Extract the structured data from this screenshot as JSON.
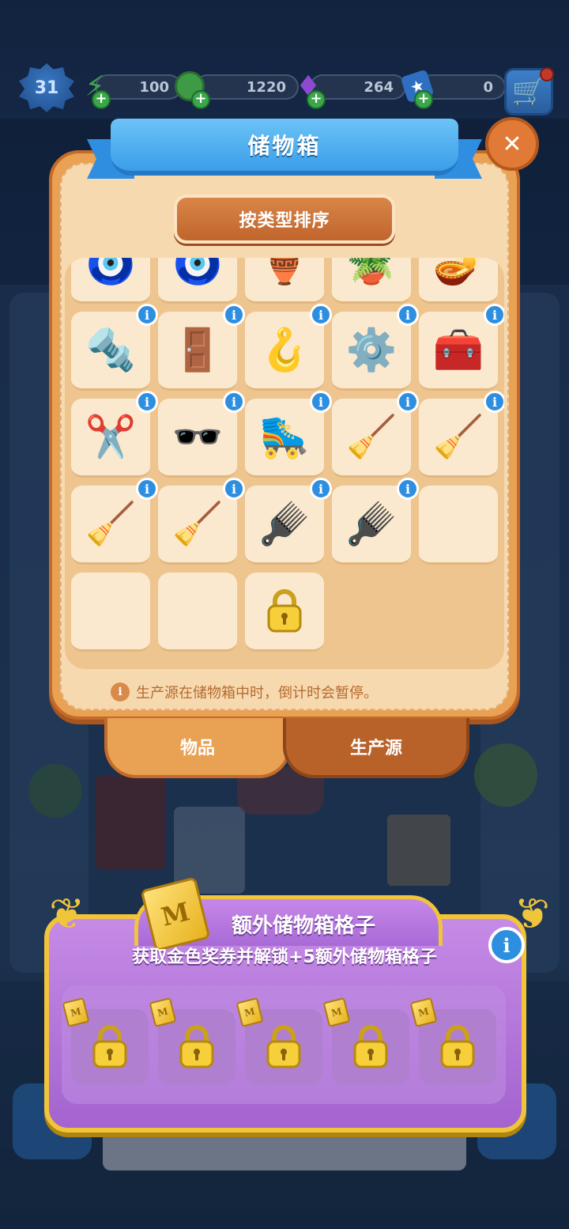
{
  "hud": {
    "level": "31",
    "energy": "100",
    "coins": "1220",
    "gems": "264",
    "stars": "0",
    "energy_icon": "lightning-icon",
    "coin_icon": "coin-icon",
    "gem_icon": "gem-icon",
    "star_icon": "star-card-icon",
    "cart_icon": "shopping-cart-icon"
  },
  "storage": {
    "title": "储物箱",
    "close_icon": "close-icon",
    "sort_label": "按类型排序",
    "note": "生产源在储物箱中时，倒计时会暂停。",
    "info_glyph": "i",
    "tabs": [
      {
        "label": "物品",
        "active": true
      },
      {
        "label": "生产源",
        "active": false
      }
    ],
    "rows": [
      [
        {
          "name": "locket",
          "glyph": "🧿",
          "partial": true
        },
        {
          "name": "locket",
          "glyph": "🧿",
          "partial": true
        },
        {
          "name": "green-vase",
          "glyph": "🏺",
          "partial": true
        },
        {
          "name": "flower-pot",
          "glyph": "🪴",
          "partial": true
        },
        {
          "name": "clay-lamp",
          "glyph": "🪔",
          "partial": true
        }
      ],
      [
        {
          "name": "knob-screws",
          "glyph": "🔩",
          "info": true
        },
        {
          "name": "door-panel",
          "glyph": "🚪",
          "info": true
        },
        {
          "name": "handle",
          "glyph": "🪝",
          "info": true
        },
        {
          "name": "nut-bolt",
          "glyph": "⚙️",
          "info": true
        },
        {
          "name": "blue-chest",
          "glyph": "🧰",
          "info": true
        }
      ],
      [
        {
          "name": "scissors-rings",
          "glyph": "✂️",
          "info": true
        },
        {
          "name": "sunglasses",
          "glyph": "🕶️",
          "info": true
        },
        {
          "name": "roller-skate",
          "glyph": "🛼",
          "info": true
        },
        {
          "name": "mop",
          "glyph": "🧹",
          "info": true
        },
        {
          "name": "dustpan-brush",
          "glyph": "🧹",
          "info": true
        }
      ],
      [
        {
          "name": "dustpan-brush",
          "glyph": "🧹",
          "info": true
        },
        {
          "name": "dustpan-brush",
          "glyph": "🧹",
          "info": true
        },
        {
          "name": "scrub-brush",
          "glyph": "🪮",
          "info": true
        },
        {
          "name": "scrub-brush",
          "glyph": "🪮",
          "info": true
        },
        {
          "name": "empty",
          "glyph": ""
        }
      ],
      [
        {
          "name": "empty",
          "glyph": ""
        },
        {
          "name": "empty",
          "glyph": ""
        },
        {
          "name": "locked",
          "glyph": "lock"
        }
      ]
    ]
  },
  "extra": {
    "title": "额外储物箱格子",
    "subtitle": "获取金色奖券并解锁+5额外储物箱格子",
    "info_glyph": "i",
    "ticket_letter": "M",
    "slot_count": 5
  },
  "colors": {
    "panel_orange": "#e9a153",
    "ribbon_blue": "#3a9ee8",
    "purple": "#a463cf",
    "gold": "#f1c53a"
  }
}
